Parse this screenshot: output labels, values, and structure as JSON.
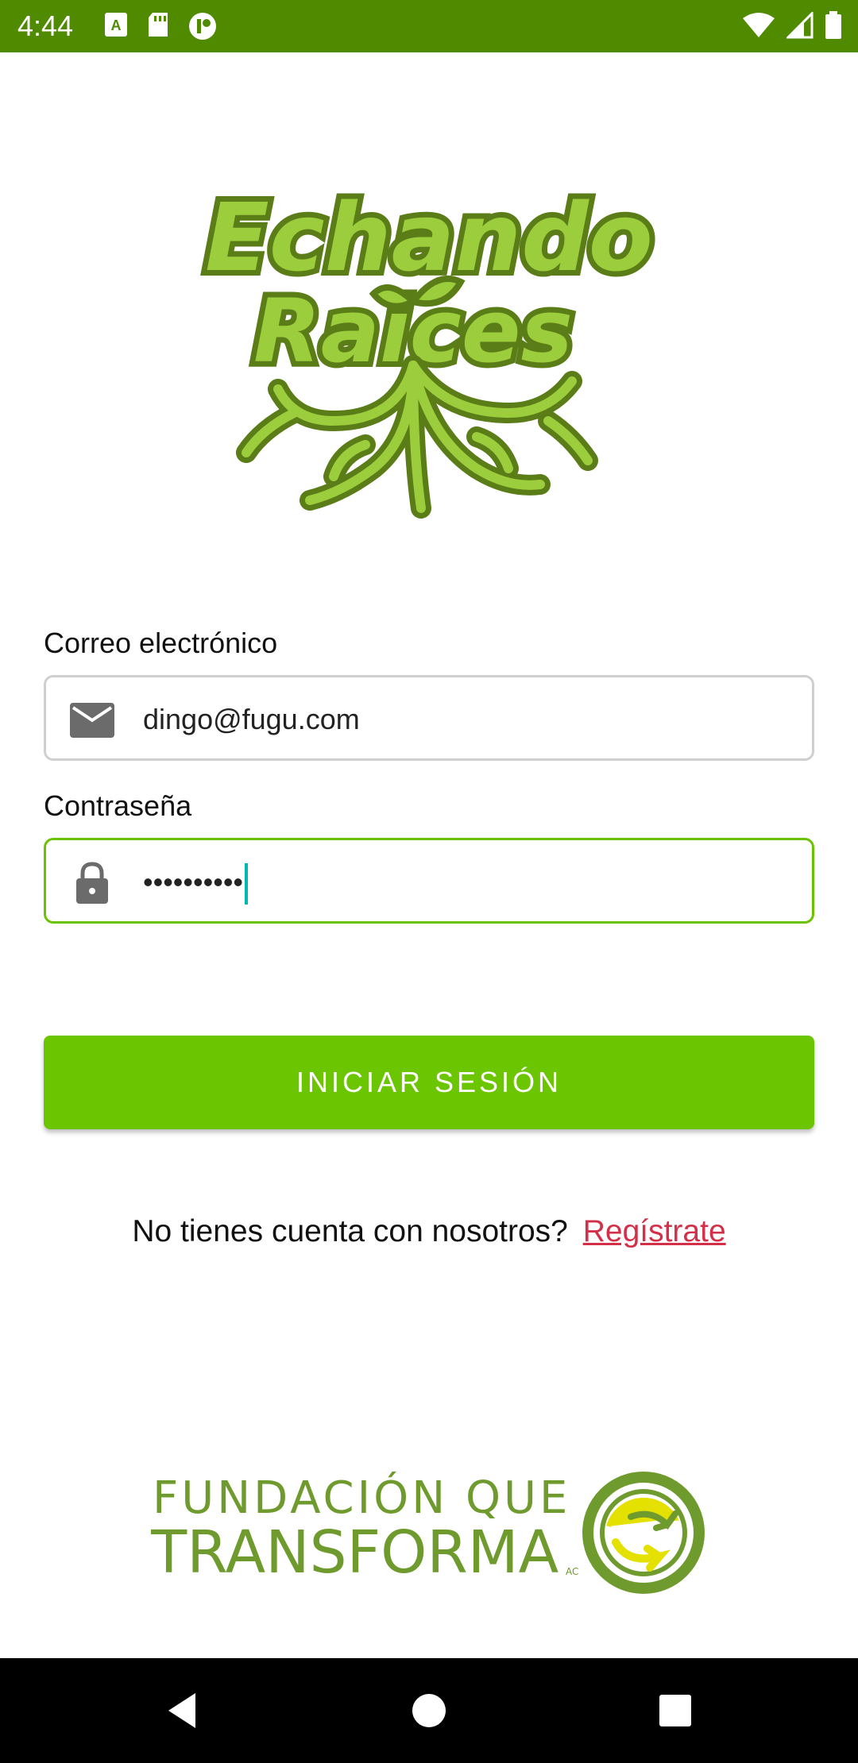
{
  "status_bar": {
    "time": "4:44",
    "left_icons": [
      "keyboard-a-icon",
      "sd-card-icon",
      "app-notification-icon"
    ],
    "right_icons": [
      "wifi-icon",
      "signal-icon",
      "battery-icon"
    ],
    "background": "#4f8a00"
  },
  "logo": {
    "line1": "Echando",
    "line2": "Raices",
    "colors": {
      "dark": "#5a7d18",
      "light": "#9ccd3c"
    }
  },
  "form": {
    "email_label": "Correo electrónico",
    "email_value": "dingo@fugu.com",
    "password_label": "Contraseña",
    "password_value": "••••••••••",
    "email_icon": "envelope-icon",
    "password_icon": "lock-icon"
  },
  "login_button": {
    "label": "INICIAR SESIÓN",
    "color": "#6bc500"
  },
  "register": {
    "prompt": "No tienes cuenta con nosotros?",
    "link": "Regístrate",
    "link_color": "#d32f48"
  },
  "footer": {
    "line1": "FUNDACIÓN QUE",
    "line2": "TRANSFORMA",
    "suffix": "AC",
    "color": "#6f9b2e"
  },
  "nav_bar": {
    "buttons": [
      "back-icon",
      "home-icon",
      "recents-icon"
    ]
  }
}
